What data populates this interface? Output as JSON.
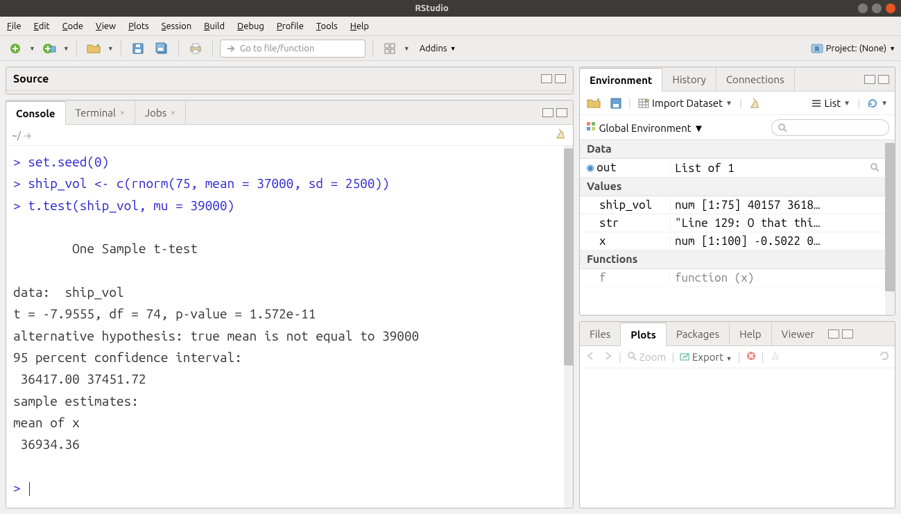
{
  "window": {
    "title": "RStudio"
  },
  "menu": [
    "File",
    "Edit",
    "Code",
    "View",
    "Plots",
    "Session",
    "Build",
    "Debug",
    "Profile",
    "Tools",
    "Help"
  ],
  "toolbar": {
    "goto_placeholder": "Go to file/function",
    "addins_label": "Addins",
    "project_label": "Project: (None)"
  },
  "source": {
    "title": "Source"
  },
  "console_tabs": {
    "console": "Console",
    "terminal": "Terminal",
    "jobs": "Jobs",
    "wd": "~/"
  },
  "console": {
    "lines": [
      {
        "type": "in",
        "text": "set.seed(0)"
      },
      {
        "type": "in",
        "text": "ship_vol <- c(rnorm(75, mean = 37000, sd = 2500))"
      },
      {
        "type": "in",
        "text": "t.test(ship_vol, mu = 39000)"
      },
      {
        "type": "out",
        "text": ""
      },
      {
        "type": "out",
        "text": "        One Sample t-test"
      },
      {
        "type": "out",
        "text": ""
      },
      {
        "type": "out",
        "text": "data:  ship_vol"
      },
      {
        "type": "out",
        "text": "t = -7.9555, df = 74, p-value = 1.572e-11"
      },
      {
        "type": "out",
        "text": "alternative hypothesis: true mean is not equal to 39000"
      },
      {
        "type": "out",
        "text": "95 percent confidence interval:"
      },
      {
        "type": "out",
        "text": " 36417.00 37451.72"
      },
      {
        "type": "out",
        "text": "sample estimates:"
      },
      {
        "type": "out",
        "text": "mean of x "
      },
      {
        "type": "out",
        "text": " 36934.36 "
      },
      {
        "type": "out",
        "text": ""
      },
      {
        "type": "prompt",
        "text": "> "
      }
    ]
  },
  "env_tabs": {
    "environment": "Environment",
    "history": "History",
    "connections": "Connections"
  },
  "env_toolbar": {
    "import": "Import Dataset",
    "list": "List",
    "scope": "Global Environment"
  },
  "env": {
    "data_header": "Data",
    "values_header": "Values",
    "functions_header": "Functions",
    "rows": {
      "out": {
        "name": "out",
        "val": "List of 1"
      },
      "ship_vol": {
        "name": "ship_vol",
        "val": "num [1:75] 40157 3618…"
      },
      "str": {
        "name": "str",
        "val": "\"Line 129: O that thi…"
      },
      "x": {
        "name": "x",
        "val": "num [1:100] -0.5022 0…"
      },
      "f": {
        "name": "f",
        "val": "function (x)"
      }
    }
  },
  "plots_tabs": {
    "files": "Files",
    "plots": "Plots",
    "packages": "Packages",
    "help": "Help",
    "viewer": "Viewer"
  },
  "plots_toolbar": {
    "zoom": "Zoom",
    "export": "Export"
  }
}
